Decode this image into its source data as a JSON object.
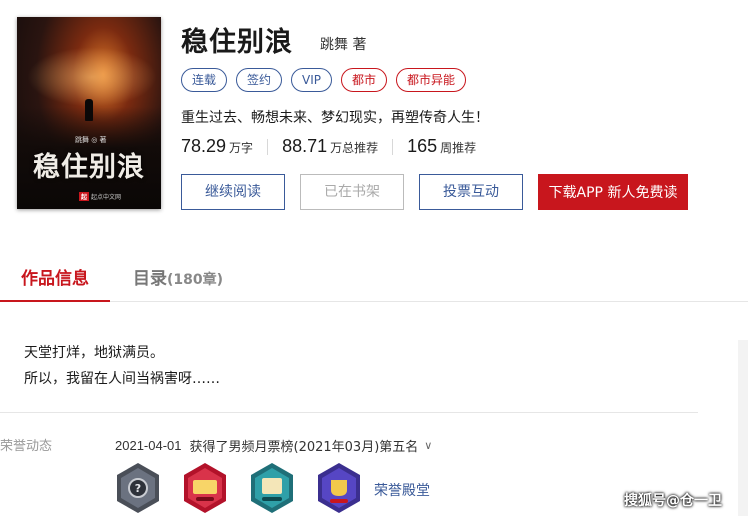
{
  "book": {
    "title": "稳住别浪",
    "author": "跳舞 著",
    "cover": {
      "author": "跳舞 ◎ 著",
      "title": "稳住别浪",
      "publisher": "起点中文网",
      "publisher_mark": "起"
    },
    "tags": [
      {
        "label": "连载",
        "color": "blue"
      },
      {
        "label": "签约",
        "color": "blue"
      },
      {
        "label": "VIP",
        "color": "blue"
      },
      {
        "label": "都市",
        "color": "red"
      },
      {
        "label": "都市异能",
        "color": "red"
      }
    ],
    "intro": "重生过去、畅想未来、梦幻现实，再塑传奇人生！",
    "stats": [
      {
        "value": "78.29",
        "unit": "万字"
      },
      {
        "value": "88.71",
        "unit": "万总推荐"
      },
      {
        "value": "165",
        "unit": "周推荐"
      }
    ]
  },
  "actions": {
    "read": "继续阅读",
    "shelf": "已在书架",
    "vote": "投票互动",
    "download": "下载APP 新人免费读"
  },
  "tabs": {
    "info": "作品信息",
    "catalog": "目录",
    "catalog_count": "(180章)"
  },
  "description": {
    "line1": "天堂打烊，地狱满员。",
    "line2": "所以，我留在人间当祸害呀……"
  },
  "honor": {
    "label": "荣誉动态",
    "date": "2021-04-01",
    "text": "获得了男频月票榜(2021年03月)第五名",
    "hall_link": "荣誉殿堂",
    "badges": [
      "rank-badge-icon",
      "boutique-badge-icon",
      "celebrity-badge-icon",
      "fist-badge-icon"
    ]
  },
  "watermark": "搜狐号@仓一卫",
  "colors": {
    "accent_red": "#c8161d",
    "accent_blue": "#3a5a99"
  }
}
